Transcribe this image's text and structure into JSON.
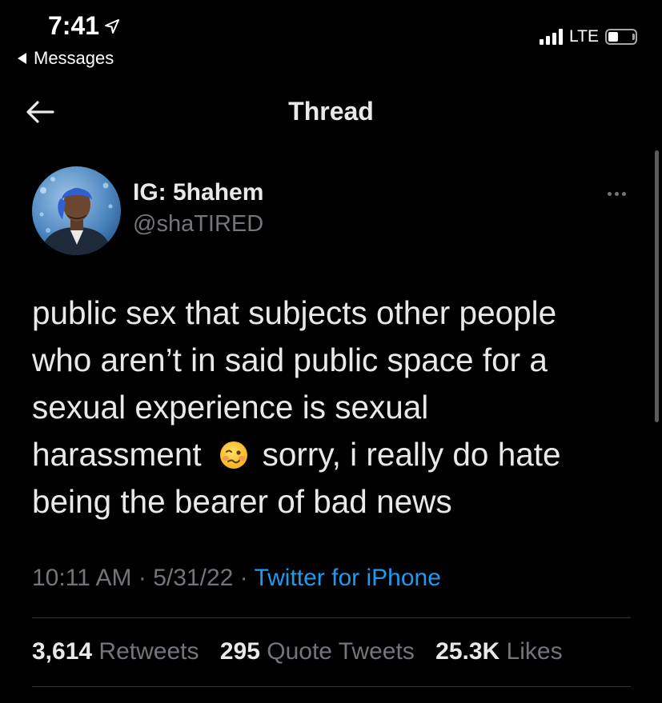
{
  "status_bar": {
    "time": "7:41",
    "back_app": "Messages",
    "network": "LTE",
    "location_icon": "location-arrow-icon",
    "battery_icon": "battery-icon",
    "signal_icon": "cellular-signal-icon"
  },
  "header": {
    "title": "Thread",
    "back_icon": "arrow-left-icon"
  },
  "tweet": {
    "author": {
      "display_name": "IG: 5hahem",
      "handle": "@shaTIRED"
    },
    "text_lines": [
      "public sex that subjects other people",
      "who aren’t in said public space for a",
      "sexual experience is sexual",
      "harassment",
      "sorry, i really do hate",
      "being the bearer of bad news"
    ],
    "emoji": "woozy-face-emoji",
    "time": "10:11 AM",
    "separator": "·",
    "date": "5/31/22",
    "source": "Twitter for iPhone",
    "stats": {
      "retweets_count": "3,614",
      "retweets_label": "Retweets",
      "quotes_count": "295",
      "quotes_label": "Quote Tweets",
      "likes_count": "25.3K",
      "likes_label": "Likes"
    }
  },
  "colors": {
    "background": "#000000",
    "primary_text": "#e7e9ea",
    "secondary_text": "#71767b",
    "link": "#1d9bf0",
    "divider": "#2f3336"
  }
}
